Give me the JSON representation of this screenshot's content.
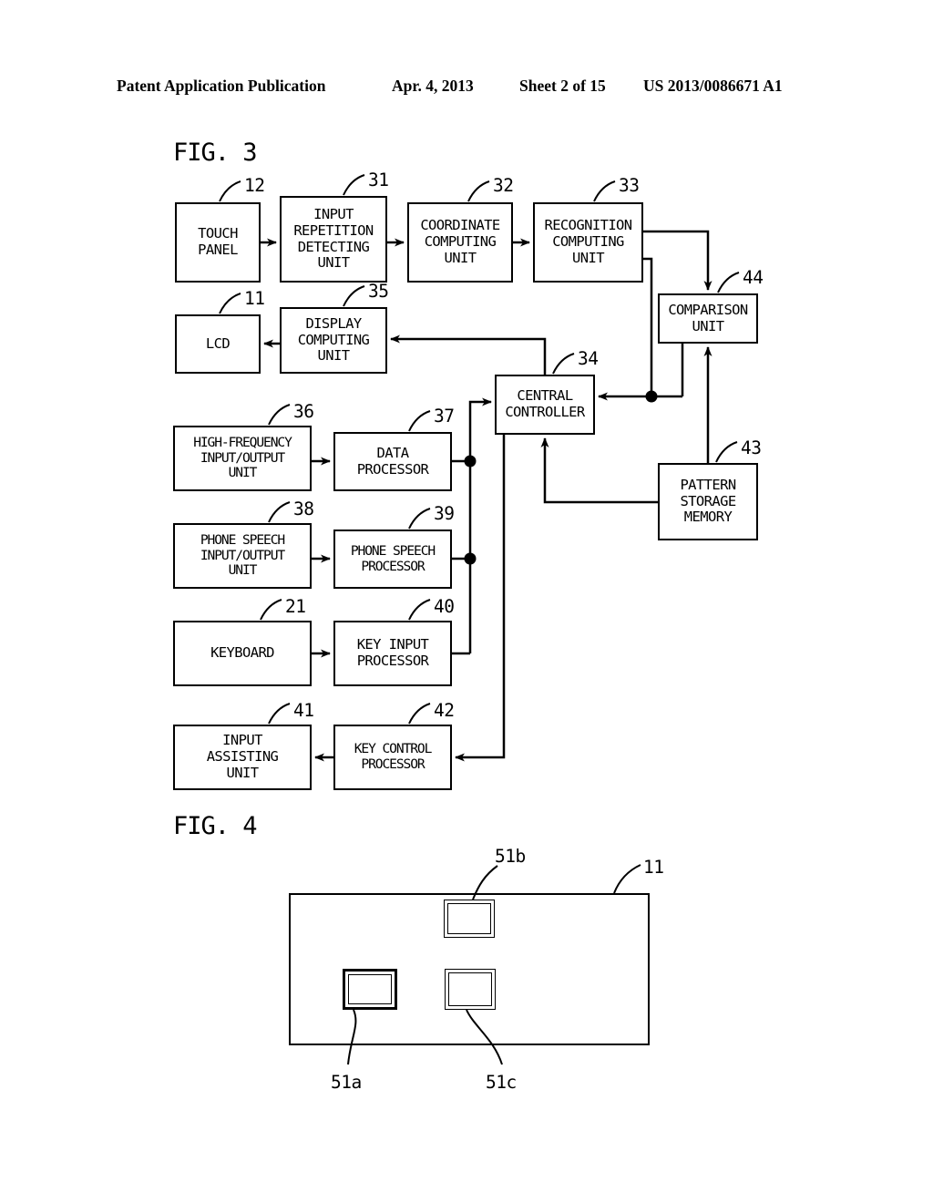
{
  "header": {
    "publication": "Patent Application Publication",
    "date": "Apr. 4, 2013",
    "sheet": "Sheet 2 of 15",
    "patent_number": "US 2013/0086671 A1"
  },
  "figures": [
    {
      "id": "fig3",
      "label": "FIG. 3"
    },
    {
      "id": "fig4",
      "label": "FIG. 4"
    }
  ],
  "fig3": {
    "title": "FIG. 3",
    "blocks": [
      {
        "ref": "12",
        "label": "TOUCH\nPANEL"
      },
      {
        "ref": "31",
        "label": "INPUT\nREPETITION\nDETECTING\nUNIT"
      },
      {
        "ref": "32",
        "label": "COORDINATE\nCOMPUTING\nUNIT"
      },
      {
        "ref": "33",
        "label": "RECOGNITION\nCOMPUTING\nUNIT"
      },
      {
        "ref": "44",
        "label": "COMPARISON\nUNIT"
      },
      {
        "ref": "11",
        "label": "LCD"
      },
      {
        "ref": "35",
        "label": "DISPLAY\nCOMPUTING\nUNIT"
      },
      {
        "ref": "34",
        "label": "CENTRAL\nCONTROLLER"
      },
      {
        "ref": "43",
        "label": "PATTERN\nSTORAGE\nMEMORY"
      },
      {
        "ref": "36",
        "label": "HIGH-FREQUENCY\nINPUT/OUTPUT\nUNIT"
      },
      {
        "ref": "37",
        "label": "DATA\nPROCESSOR"
      },
      {
        "ref": "38",
        "label": "PHONE SPEECH\nINPUT/OUTPUT\nUNIT"
      },
      {
        "ref": "39",
        "label": "PHONE SPEECH\nPROCESSOR"
      },
      {
        "ref": "21",
        "label": "KEYBOARD"
      },
      {
        "ref": "40",
        "label": "KEY INPUT\nPROCESSOR"
      },
      {
        "ref": "41",
        "label": "INPUT\nASSISTING\nUNIT"
      },
      {
        "ref": "42",
        "label": "KEY CONTROL\nPROCESSOR"
      }
    ]
  },
  "fig4": {
    "title": "FIG. 4",
    "panel_ref": "11",
    "keys": [
      {
        "ref": "51a",
        "position": "lower-left",
        "emphasis": "thick"
      },
      {
        "ref": "51b",
        "position": "upper-middle",
        "emphasis": "normal"
      },
      {
        "ref": "51c",
        "position": "lower-middle",
        "emphasis": "normal"
      }
    ]
  },
  "colors": {
    "ink": "#000000",
    "paper": "#ffffff"
  }
}
